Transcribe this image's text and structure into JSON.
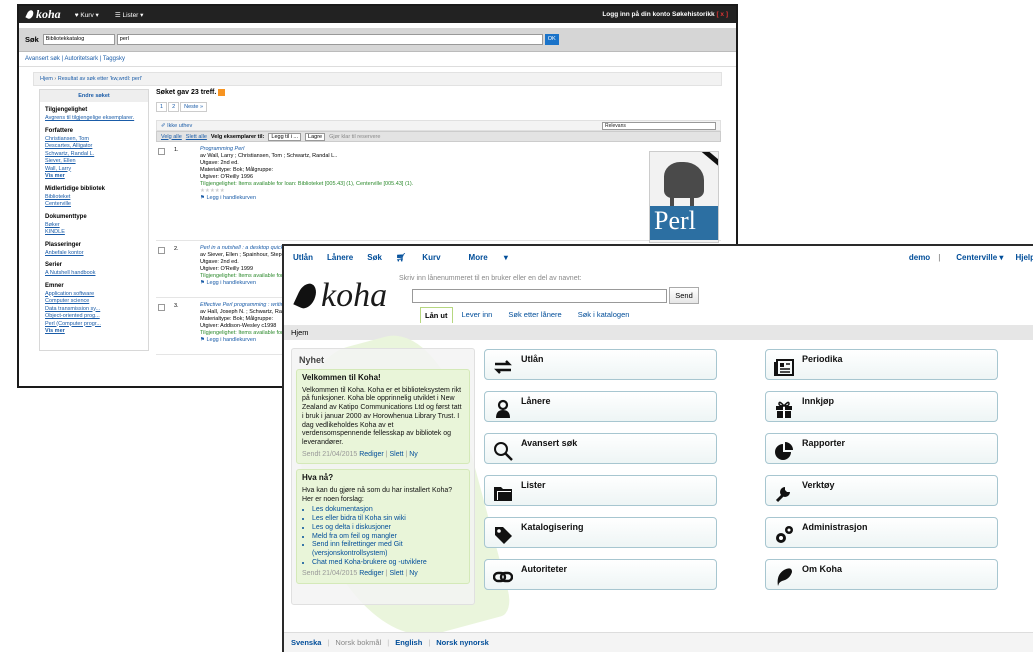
{
  "opac": {
    "topbar": {
      "brand": "koha",
      "cart": "Kurv",
      "lists": "Lister",
      "right": "Logg inn på din konto  Søkehistorikk",
      "clear": "[ x ]"
    },
    "search": {
      "label": "Søk",
      "scope": "Bibliotekkatalog",
      "query": "perl",
      "button": "OK"
    },
    "links": "Avansert søk | Autoritetsark | Taggsky",
    "breadcrumb": {
      "home": "Hjem",
      "current": "Resultat av søk etter 'kw,wrdl: perl'"
    },
    "refine": {
      "header": "Endre søket",
      "availability_h": "Tilgjengelighet",
      "availability": "Avgrens til tilgjengelige eksemplarer.",
      "authors_h": "Forfattere",
      "authors": [
        "Christiansen, Tom",
        "Descartes, Alligator",
        "Schwartz, Randal L.",
        "Siever, Ellen",
        "Wall, Larry"
      ],
      "more": "Vis mer",
      "libraries_h": "Midlertidige bibliotek",
      "libraries": [
        "Biblioteket",
        "Centerville"
      ],
      "doctype_h": "Dokumenttype",
      "doctypes": [
        "Bøker",
        "KINDLE"
      ],
      "locations_h": "Plasseringer",
      "locations": [
        "Anbefale kontor"
      ],
      "series_h": "Serier",
      "series": [
        "A Nutshell handbook"
      ],
      "subjects_h": "Emner",
      "subjects": [
        "Application software",
        "Computer science",
        "Data transmission sy...",
        "Object-oriented prog...",
        "Perl (Computer progr..."
      ],
      "more2": "Vis mer"
    },
    "results": {
      "hits": "Søket gav 23 treff.",
      "pages": [
        "1",
        "2",
        "Neste »"
      ],
      "unhighlight": "Ikke uthev",
      "sort": "Relevans",
      "select_all": "Velg alle",
      "clear_all": "Slett alle",
      "selected_to": "Velg eksemplarer til:",
      "list_select": "Legg til i ...",
      "save": "Lagre",
      "place_hold": "Gjør klar til reservere",
      "records": [
        {
          "num": "1.",
          "title": "Programming Perl",
          "authors": "av Wall, Larry ; Christiansen, Tom ; Schwartz, Randal L..",
          "edition": "Utgave: 2nd ed.",
          "material": "Materialtype: Bok; Målgruppe:",
          "publisher": "Utgiver: O'Reilly 1996",
          "availability": "Tilgjengelighet: Items available for loan: Biblioteket [005.43] (1), Centerville [005.43] (1).",
          "cart": "Legg i handlekurven"
        },
        {
          "num": "2.",
          "title": "Perl in a nutshell : a desktop quick refe",
          "authors": "av Siever, Ellen ; Spainhour, Stephen",
          "edition": "Utgave: 2nd ed.",
          "material": "Materialtype: Bok; Målgruppe:",
          "publisher": "Utgiver: O'Reilly 1999",
          "availability": "Tilgjengelighet: Items available for loan: B",
          "cart": "Legg i handlekurven"
        },
        {
          "num": "3.",
          "title": "Effective Perl programming : writing bet",
          "authors": "av Hall, Joseph N. ; Schwartz, Randal L",
          "edition": "",
          "material": "Materialtype: Bok; Målgruppe:",
          "publisher": "Utgiver: Addison-Wesley c1998",
          "availability": "Tilgjengelighet: Items available for loan: B",
          "cart": "Legg i handlekurven"
        }
      ],
      "cover_text": "Perl"
    }
  },
  "staff": {
    "nav": [
      "Utlån",
      "Lånere",
      "Søk",
      "Kurv",
      "More"
    ],
    "user": "demo",
    "branch": "Centerville",
    "help": "Hjelp",
    "logo": "koha",
    "hint": "Skriv inn lånenummeret til en bruker eller en del av navnet:",
    "send": "Send",
    "tabs": [
      "Lån ut",
      "Lever inn",
      "Søk etter lånere",
      "Søk i katalogen"
    ],
    "breadcrumb": "Hjem",
    "news": {
      "heading": "Nyhet",
      "items": [
        {
          "title": "Velkommen til Koha!",
          "body": "Velkommen til Koha. Koha er et biblioteksystem rikt på funksjoner. Koha ble opprinnelig utviklet i New Zealand av Katipo Communications Ltd og først tatt i bruk i januar 2000 av Horowhenua Library Trust. I dag vedlikeholdes Koha av et verdensomspennende fellesskap av bibliotek og leverandører.",
          "date": "Sendt 21/04/2015",
          "edit": "Rediger",
          "delete": "Slett",
          "new": "Ny"
        },
        {
          "title": "Hva nå?",
          "body": "Hva kan du gjøre nå som du har installert Koha? Her er noen forslag:",
          "list": [
            "Les dokumentasjon",
            "Les eller bidra til Koha sin wiki",
            "Les og delta i diskusjoner",
            "Meld fra om feil og mangler",
            "Send inn feilrettinger med Git (versjonskontrollsystem)",
            "Chat med Koha-brukere og -utviklere"
          ],
          "date": "Sendt 21/04/2015",
          "edit": "Rediger",
          "delete": "Slett",
          "new": "Ny"
        }
      ]
    },
    "modules_left": [
      {
        "label": "Utlån",
        "icon": "arrows-icon"
      },
      {
        "label": "Lånere",
        "icon": "patron-icon"
      },
      {
        "label": "Avansert søk",
        "icon": "magnifier-icon"
      },
      {
        "label": "Lister",
        "icon": "folder-icon"
      },
      {
        "label": "Katalogisering",
        "icon": "tag-icon"
      },
      {
        "label": "Autoriteter",
        "icon": "link-icon"
      }
    ],
    "modules_right": [
      {
        "label": "Periodika",
        "icon": "newspaper-icon"
      },
      {
        "label": "Innkjøp",
        "icon": "gift-icon"
      },
      {
        "label": "Rapporter",
        "icon": "pie-chart-icon"
      },
      {
        "label": "Verktøy",
        "icon": "wrench-icon"
      },
      {
        "label": "Administrasjon",
        "icon": "gears-icon"
      },
      {
        "label": "Om Koha",
        "icon": "koha-leaf-icon"
      }
    ],
    "languages": [
      "Svenska",
      "Norsk bokmål",
      "English",
      "Norsk nynorsk"
    ]
  }
}
